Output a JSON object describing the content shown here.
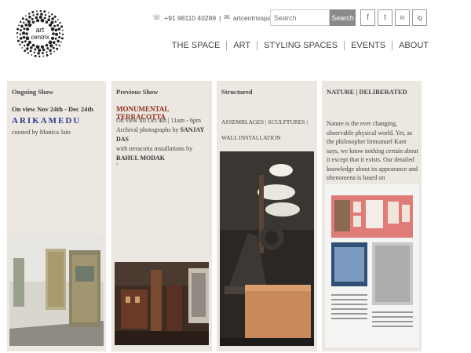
{
  "header": {
    "logo_text_top": "art",
    "logo_text_bottom": "centrix",
    "phone": "+91 98110 40289",
    "email": "artcentrixspace@gmail.com",
    "search_placeholder": "Search",
    "search_button": "Search",
    "social": [
      "f",
      "t",
      "in",
      "ig"
    ]
  },
  "nav": [
    "THE SPACE",
    "ART",
    "STYLING SPACES",
    "EVENTS",
    "ABOUT"
  ],
  "panels": {
    "ongoing": {
      "title": "Ongoing Show",
      "dates": "On view Nov 24th - Dec 24th",
      "show": "ARIKAMEDU",
      "curator": "curated by Monica Jain"
    },
    "previous": {
      "title": "Previous Show",
      "show": "MONUMENTAL TERRACOTTA",
      "line1": "On view till Oct 4th | 11am - 6pm",
      "line2_a": "Archival photographs by ",
      "line2_b": "SANJAY DAS",
      "line3": "with terracotta installations by ",
      "line3_b": "RAHUL MODAK",
      "chevron": "‹"
    },
    "structured": {
      "title": "Structured",
      "text": "ASSEMBLAGES | SCULPTURES | WALL INSTALLATION"
    },
    "nature": {
      "title": "NATURE | DELIBERATED",
      "text": "Nature is the ever changing, observable physical world. Yet, as the philosopher Immanuel Kant says, we know nothing certain about it except that it exists. Our detailed knowledge about its appearance and phenomena is based on"
    }
  }
}
